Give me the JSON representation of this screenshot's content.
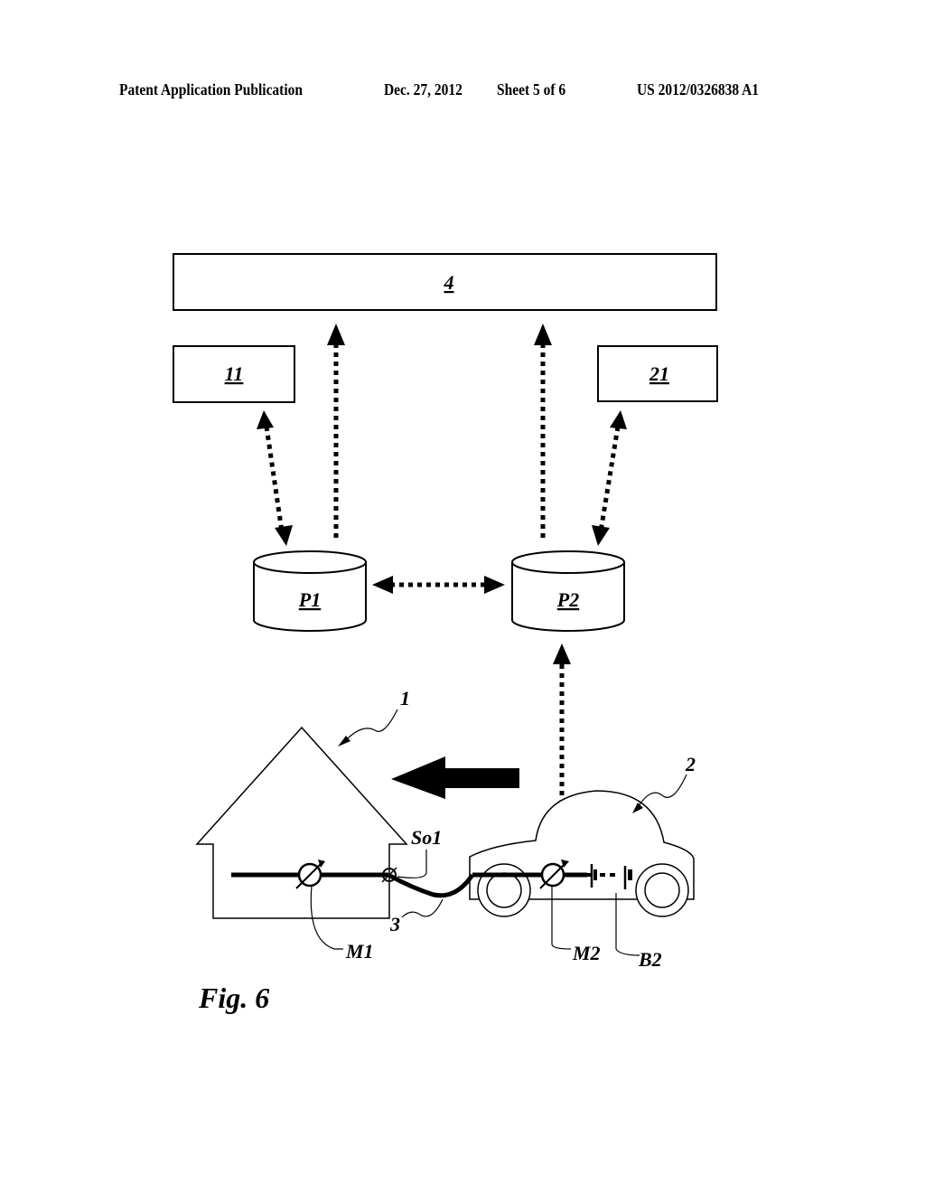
{
  "header": {
    "publication": "Patent Application Publication",
    "date": "Dec. 27, 2012",
    "sheet": "Sheet 5 of 6",
    "number": "US 2012/0326838 A1"
  },
  "figure": {
    "caption": "Fig. 6",
    "boxes": {
      "top": "4",
      "left": "11",
      "right": "21"
    },
    "databases": {
      "left": "P1",
      "right": "P2"
    },
    "labels": {
      "house": "1",
      "vehicle": "2",
      "cable": "3",
      "socket": "So1",
      "meter_house": "M1",
      "meter_vehicle": "M2",
      "battery": "B2"
    },
    "power_flow_direction": "vehicle-to-house"
  }
}
